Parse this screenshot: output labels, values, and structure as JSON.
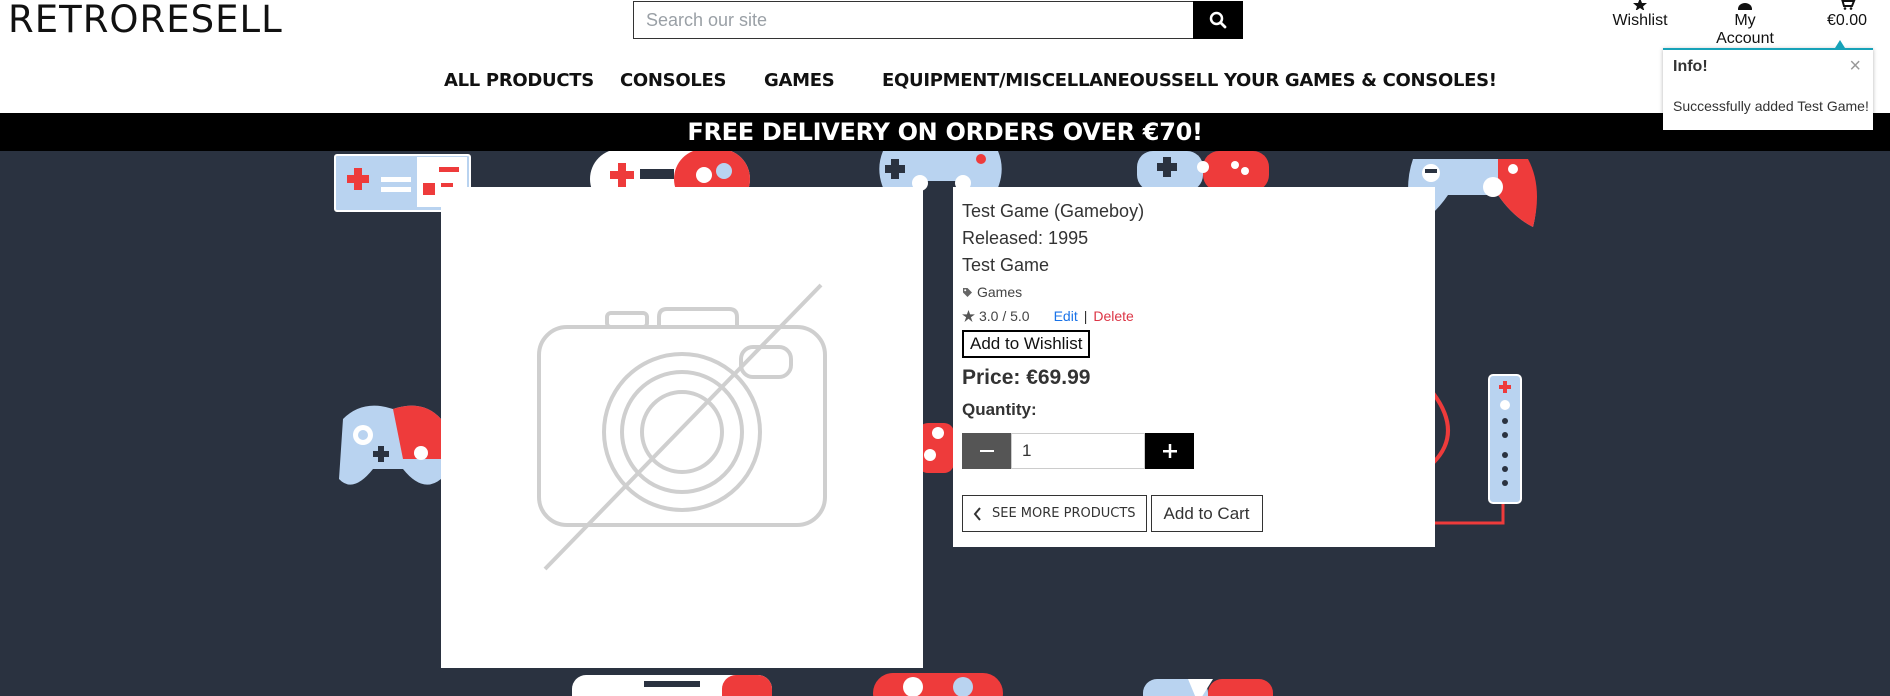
{
  "header": {
    "logo": "RETRORESELL",
    "search_placeholder": "Search our site",
    "wishlist_label": "Wishlist",
    "account_label": "My Account",
    "cart_total": "€0.00"
  },
  "nav": {
    "items": [
      "ALL PRODUCTS",
      "CONSOLES",
      "GAMES",
      "EQUIPMENT/MISCELLANEOUS",
      "SELL YOUR GAMES & CONSOLES!"
    ]
  },
  "banner": "FREE DELIVERY ON ORDERS OVER €70!",
  "product": {
    "name": "Test Game (Gameboy)",
    "released": "Released: 1995",
    "description": "Test Game",
    "category": "Games",
    "rating": "3.0 / 5.0",
    "edit_label": "Edit",
    "separator": "|",
    "delete_label": "Delete",
    "wishlist_button": "Add to Wishlist",
    "price": "Price: €69.99",
    "quantity_label": "Quantity:",
    "quantity_value": "1",
    "see_more_label": "SEE MORE PRODUCTS",
    "add_to_cart_label": "Add to Cart"
  },
  "toast": {
    "title": "Info!",
    "close": "×",
    "message": "Successfully added Test Game!"
  },
  "colors": {
    "bg_dark": "#2a3240",
    "accent_red": "#ee3b3b",
    "accent_blue": "#b9d3f0",
    "toast_border": "#17a2b8",
    "link_blue": "#1a73e8",
    "delete_red": "#dc3545"
  }
}
